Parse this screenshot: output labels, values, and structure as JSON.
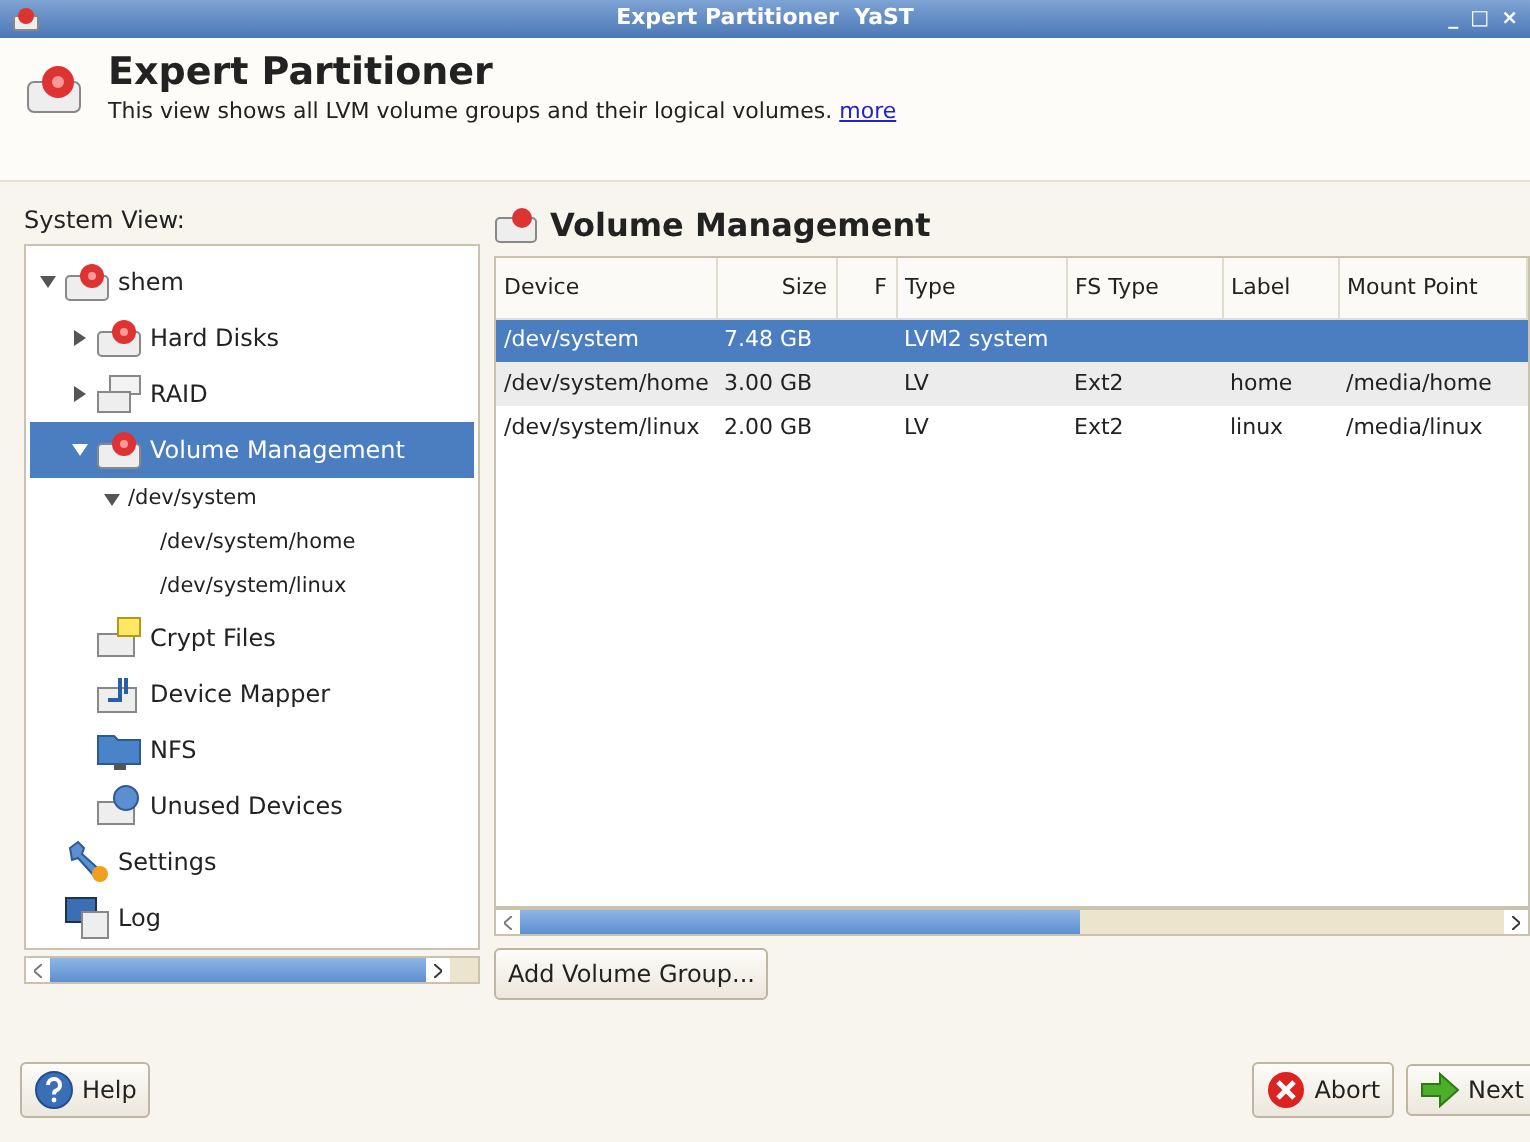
{
  "window": {
    "title": "Expert Partitioner  YaST",
    "controls": [
      "_",
      "□",
      "×"
    ]
  },
  "header": {
    "title": "Expert Partitioner",
    "description": "This view shows all LVM volume groups and their logical volumes.",
    "link": "more"
  },
  "sidebar": {
    "label": "System View:",
    "items": [
      {
        "label": "shem",
        "kind": "disk",
        "expanded": true,
        "selected": false,
        "children": [
          {
            "label": "Hard Disks",
            "kind": "disk",
            "expanded": false,
            "selected": false
          },
          {
            "label": "RAID",
            "kind": "raid",
            "expanded": false,
            "selected": false
          },
          {
            "label": "Volume Management",
            "kind": "disk",
            "expanded": true,
            "selected": true,
            "children": [
              {
                "label": "/dev/system",
                "kind": "none",
                "expanded": true,
                "selected": false,
                "children": [
                  {
                    "label": "/dev/system/home",
                    "kind": "none",
                    "selected": false
                  },
                  {
                    "label": "/dev/system/linux",
                    "kind": "none",
                    "selected": false
                  }
                ]
              }
            ]
          },
          {
            "label": "Crypt Files",
            "kind": "crypt",
            "selected": false
          },
          {
            "label": "Device Mapper",
            "kind": "mapper",
            "selected": false
          },
          {
            "label": "NFS",
            "kind": "nfs",
            "selected": false
          },
          {
            "label": "Unused Devices",
            "kind": "unused",
            "selected": false
          }
        ]
      },
      {
        "label": "Settings",
        "kind": "settings",
        "selected": false
      },
      {
        "label": "Log",
        "kind": "log",
        "selected": false
      }
    ]
  },
  "main": {
    "title": "Volume Management",
    "table": {
      "columns": [
        "Device",
        "Size",
        "F",
        "Type",
        "FS Type",
        "Label",
        "Mount Point"
      ],
      "rows": [
        {
          "cells": [
            "/dev/system",
            "7.48 GB",
            "",
            "LVM2 system",
            "",
            "",
            ""
          ],
          "selected": true
        },
        {
          "cells": [
            "/dev/system/home",
            "3.00 GB",
            "",
            "LV",
            "Ext2",
            "home",
            "/media/home"
          ],
          "selected": false
        },
        {
          "cells": [
            "/dev/system/linux",
            "2.00 GB",
            "",
            "LV",
            "Ext2",
            "linux",
            "/media/linux"
          ],
          "selected": false
        }
      ]
    },
    "add_button": {
      "label": "Add Volume Group..."
    }
  },
  "footer": {
    "help": {
      "label": "Help"
    },
    "abort": {
      "label": "Abort"
    },
    "next": {
      "label": "Next"
    }
  }
}
